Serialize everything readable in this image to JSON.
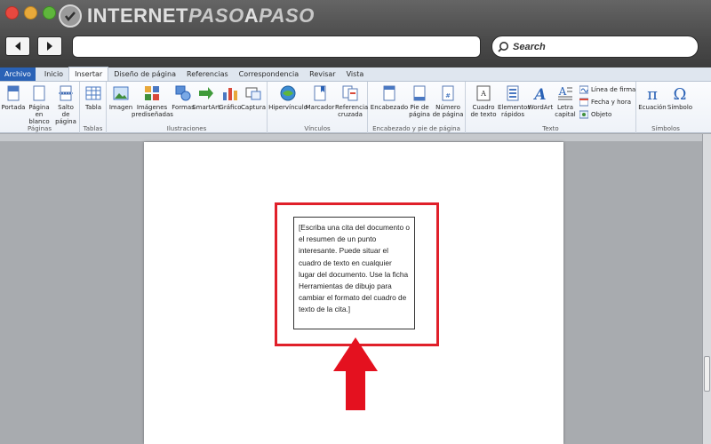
{
  "brand": {
    "logo_text_1": "INTERNET",
    "logo_text_2": "PASO",
    "logo_text_3": "A",
    "logo_text_4": "PASO"
  },
  "browser": {
    "search_placeholder": "Search"
  },
  "ribbon_tabs": [
    "Archivo",
    "Inicio",
    "Insertar",
    "Diseño de página",
    "Referencias",
    "Correspondencia",
    "Revisar",
    "Vista"
  ],
  "groups": {
    "paginas": {
      "label": "Páginas",
      "buttons": [
        "Portada",
        "Página en blanco",
        "Salto de página"
      ]
    },
    "tablas": {
      "label": "Tablas",
      "buttons": [
        "Tabla"
      ]
    },
    "ilustraciones": {
      "label": "Ilustraciones",
      "buttons": [
        "Imagen",
        "Imágenes prediseñadas",
        "Formas",
        "SmartArt",
        "Gráfico",
        "Captura"
      ]
    },
    "vinculos": {
      "label": "Vínculos",
      "buttons": [
        "Hipervínculo",
        "Marcador",
        "Referencia cruzada"
      ]
    },
    "encabezado": {
      "label": "Encabezado y pie de página",
      "buttons": [
        "Encabezado",
        "Pie de página",
        "Número de página"
      ]
    },
    "texto": {
      "label": "Texto",
      "buttons": [
        "Cuadro de texto",
        "Elementos rápidos",
        "WordArt",
        "Letra capital"
      ],
      "small": [
        "Línea de firma",
        "Fecha y hora",
        "Objeto"
      ]
    },
    "simbolos": {
      "label": "Símbolos",
      "buttons": [
        "Ecuación",
        "Símbolo"
      ]
    }
  },
  "textbox": {
    "content": "[Escriba una cita del documento o el resumen de un punto interesante. Puede situar el cuadro de texto en cualquier lugar del documento. Use la ficha Herramientas de dibujo para cambiar el formato del cuadro de texto de la cita.]"
  },
  "colors": {
    "highlight": "#e0202a",
    "file_tab": "#2a62b6"
  }
}
